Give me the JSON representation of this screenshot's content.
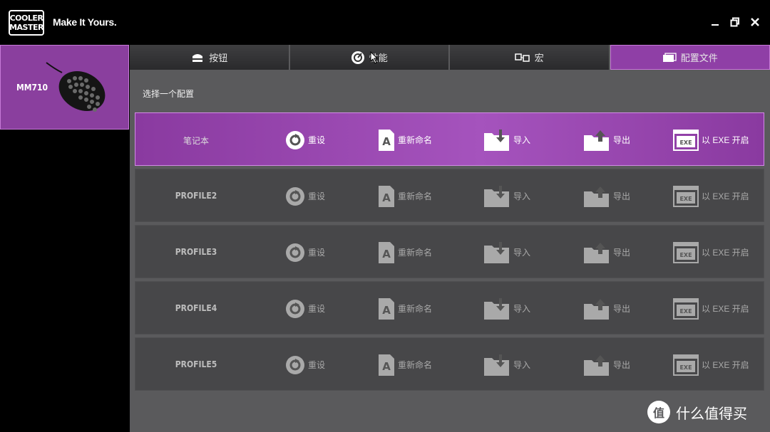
{
  "brand": {
    "logo_line1": "COOLER",
    "logo_line2": "MASTER",
    "tagline": "Make It Yours."
  },
  "window_controls": [
    "minimize",
    "restore",
    "close"
  ],
  "device": {
    "name": "MM710"
  },
  "tabs": [
    {
      "label": "按钮",
      "icon": "mouse-buttons-icon",
      "active": false
    },
    {
      "label": "性能",
      "icon": "performance-icon",
      "active": false
    },
    {
      "label": "宏",
      "icon": "macro-icon",
      "active": false
    },
    {
      "label": "配置文件",
      "icon": "profile-icon",
      "active": true
    }
  ],
  "profiles_section": {
    "title": "选择一个配置"
  },
  "profiles": [
    {
      "name": "笔记本",
      "active": true
    },
    {
      "name": "PROFILE2",
      "active": false
    },
    {
      "name": "PROFILE3",
      "active": false
    },
    {
      "name": "PROFILE4",
      "active": false
    },
    {
      "name": "PROFILE5",
      "active": false
    }
  ],
  "actions": {
    "reset": "重设",
    "rename": "重新命名",
    "import": "导入",
    "export": "导出",
    "exe": "以 EXE 开启",
    "exe_badge": "EXE"
  },
  "watermark": {
    "badge": "值",
    "text": "什么值得买"
  },
  "colors": {
    "accent": "#8f3fa6",
    "accent_border": "#c77ad8",
    "panel": "#5a5a5c",
    "row": "#474749"
  }
}
